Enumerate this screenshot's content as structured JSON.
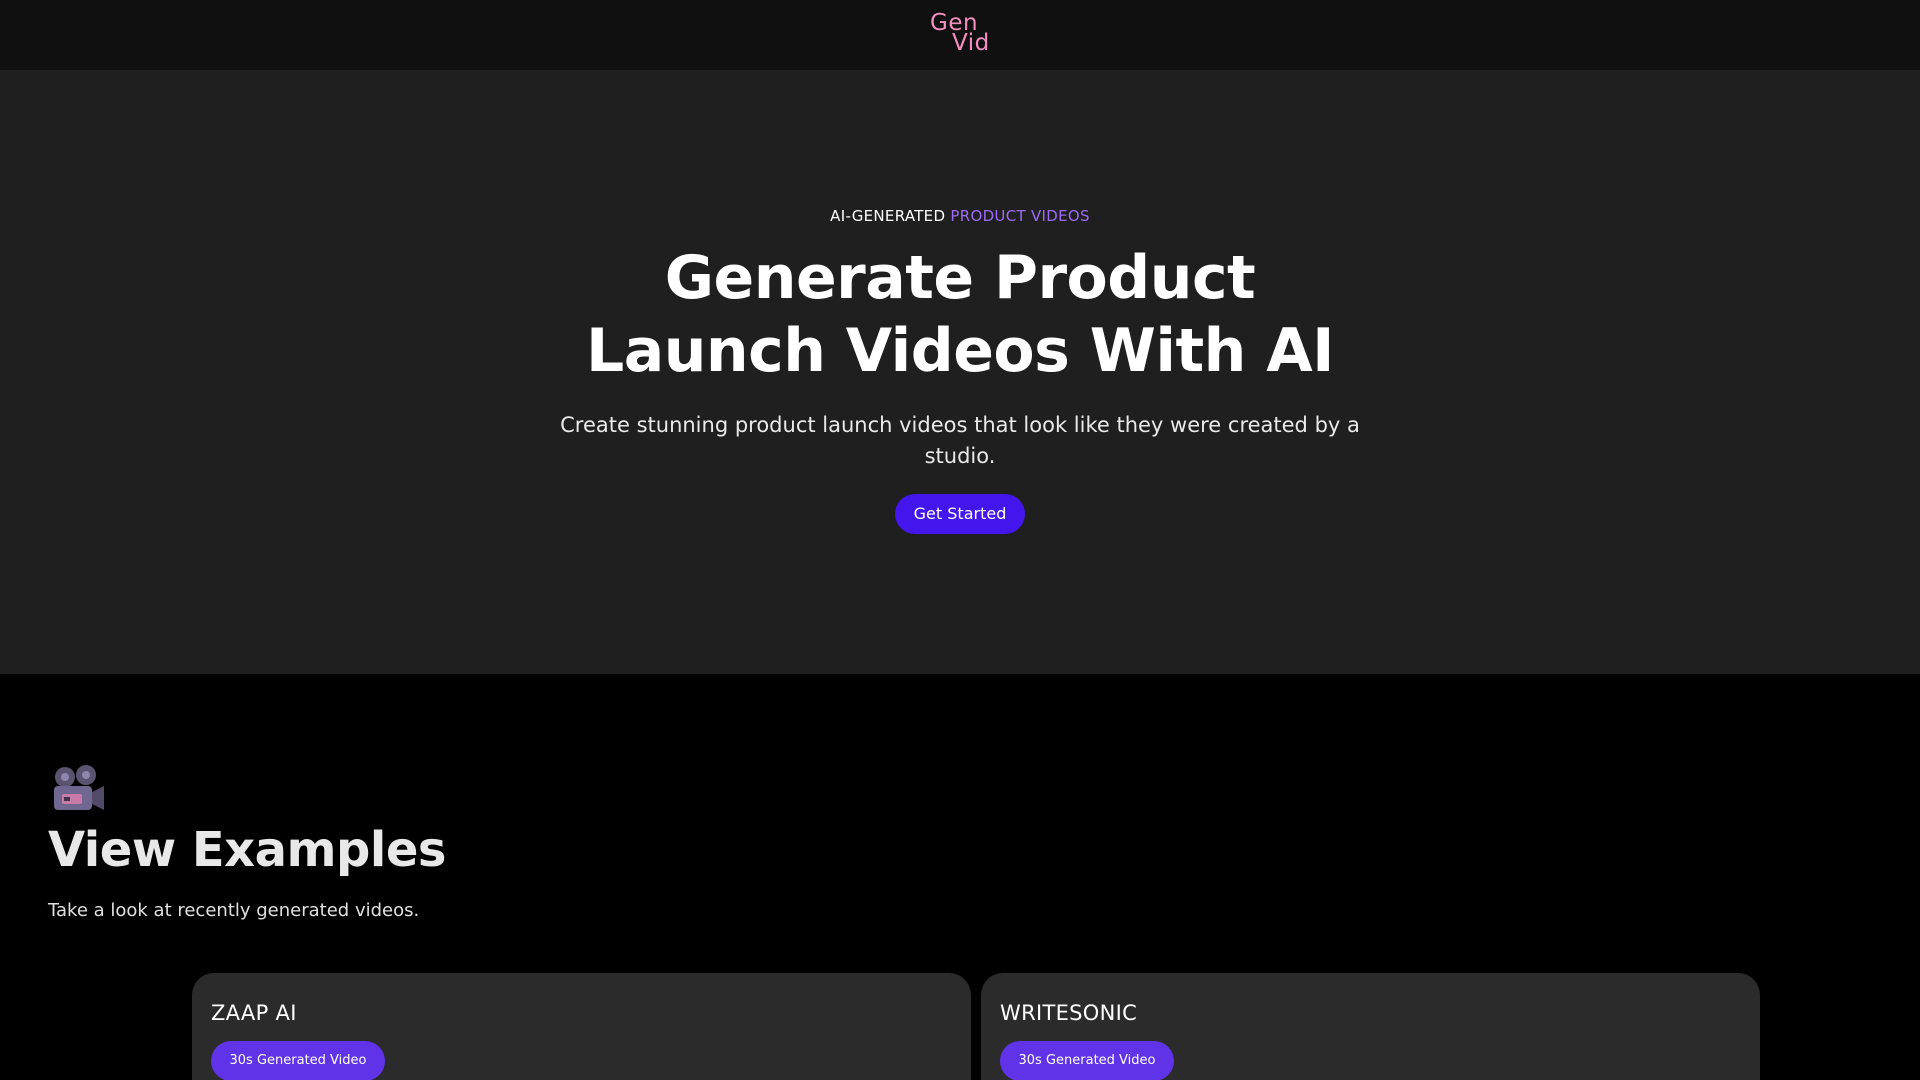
{
  "header": {
    "logo_line1": "Gen",
    "logo_line2": "Vid"
  },
  "hero": {
    "eyebrow_white": "AI-GENERATED",
    "eyebrow_purple": "PRODUCT VIDEOS",
    "title": "Generate Product Launch Videos With AI",
    "subtitle": "Create stunning product launch videos that look like they were created by a studio.",
    "cta_label": "Get Started"
  },
  "examples": {
    "icon": "movie-camera-icon",
    "title": "View Examples",
    "subtitle": "Take a look at recently generated videos.",
    "cards": [
      {
        "title": "ZAAP AI",
        "badge": "30s Generated Video"
      },
      {
        "title": "WRITESONIC",
        "badge": "30s Generated Video"
      }
    ]
  },
  "colors": {
    "logo": "#f48fc0",
    "accent_purple": "#9d6bf5",
    "cta": "#4316ee",
    "badge": "#6033e8",
    "hero_bg": "#1f1f1f",
    "topbar_bg": "#101010",
    "card_bg": "#2b2b2b"
  }
}
